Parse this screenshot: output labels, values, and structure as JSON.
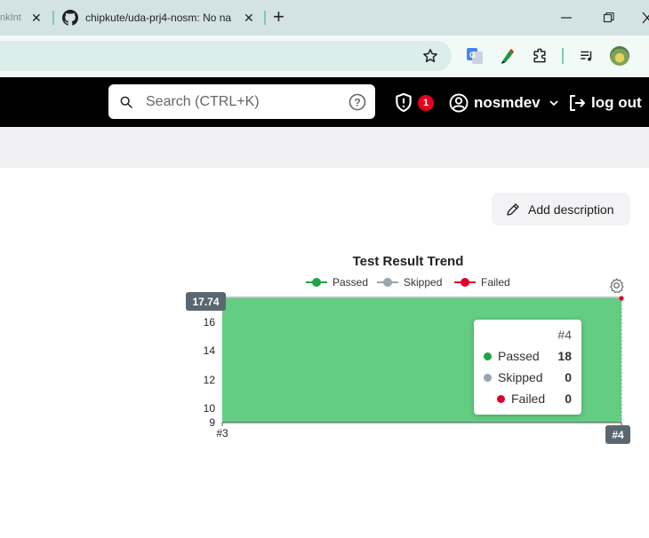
{
  "browser": {
    "tabs": [
      {
        "label": "nkInt"
      },
      {
        "label": "chipkute/uda-prj4-nosm: No na"
      }
    ],
    "new_tab": "+"
  },
  "header": {
    "search_placeholder": "Search (CTRL+K)",
    "notification_count": "1",
    "username": "nosmdev",
    "logout_label": "log out"
  },
  "main": {
    "add_description_label": "Add description"
  },
  "colors": {
    "passed": "#1ea446",
    "skipped": "#9aa5ad",
    "failed": "#e1002d",
    "area_fill": "#63cd82",
    "notification": "#e6001f"
  },
  "chart_data": {
    "type": "area",
    "title": "Test Result Trend",
    "categories": [
      "#3",
      "#4"
    ],
    "series": [
      {
        "name": "Passed",
        "values": [
          18,
          18
        ]
      },
      {
        "name": "Skipped",
        "values": [
          0,
          0
        ]
      },
      {
        "name": "Failed",
        "values": [
          0,
          0
        ]
      }
    ],
    "yticks": [
      "9",
      "10",
      "12",
      "14",
      "16"
    ],
    "ylim": [
      9,
      17.74
    ],
    "y_pointer_label": "17.74",
    "x_pointer_label": "#4",
    "legend_position": "top",
    "tooltip": {
      "title": "#4",
      "rows": [
        {
          "label": "Passed",
          "value": "18"
        },
        {
          "label": "Skipped",
          "value": "0"
        },
        {
          "label": "Failed",
          "value": "0"
        }
      ]
    }
  }
}
